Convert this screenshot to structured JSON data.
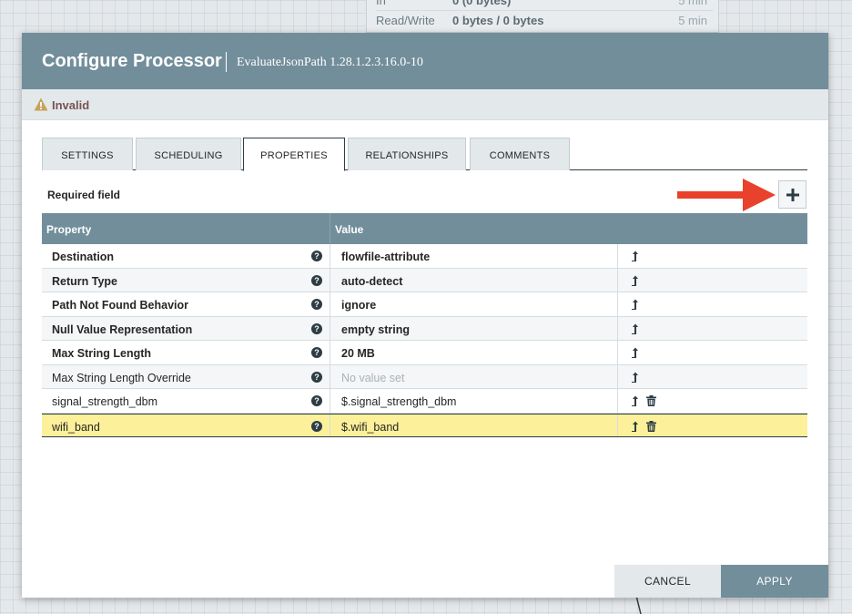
{
  "background": {
    "stats": [
      {
        "label": "In",
        "value": "0 (0 bytes)",
        "time": "5 min"
      },
      {
        "label": "Read/Write",
        "value": "0 bytes / 0 bytes",
        "time": "5 min"
      }
    ]
  },
  "dialog": {
    "title": "Configure Processor",
    "subtitle": "EvaluateJsonPath 1.28.1.2.3.16.0-10",
    "status": "Invalid",
    "tabs": [
      {
        "label": "SETTINGS",
        "active": false
      },
      {
        "label": "SCHEDULING",
        "active": false
      },
      {
        "label": "PROPERTIES",
        "active": true
      },
      {
        "label": "RELATIONSHIPS",
        "active": false
      },
      {
        "label": "COMMENTS",
        "active": false
      }
    ],
    "required_label": "Required field",
    "add_icon": "plus-icon",
    "table": {
      "headers": [
        "Property",
        "Value"
      ],
      "rows": [
        {
          "name": "Destination",
          "value": "flowfile-attribute",
          "required": true,
          "deletable": false
        },
        {
          "name": "Return Type",
          "value": "auto-detect",
          "required": true,
          "deletable": false
        },
        {
          "name": "Path Not Found Behavior",
          "value": "ignore",
          "required": true,
          "deletable": false
        },
        {
          "name": "Null Value Representation",
          "value": "empty string",
          "required": true,
          "deletable": false
        },
        {
          "name": "Max String Length",
          "value": "20 MB",
          "required": true,
          "deletable": false
        },
        {
          "name": "Max String Length Override",
          "value": "No value set",
          "required": false,
          "deletable": false
        },
        {
          "name": "signal_strength_dbm",
          "value": "$.signal_strength_dbm",
          "required": false,
          "deletable": true
        },
        {
          "name": "wifi_band",
          "value": "$.wifi_band",
          "required": false,
          "deletable": true,
          "selected": true
        }
      ]
    },
    "cancel_label": "CANCEL",
    "apply_label": "APPLY"
  },
  "colors": {
    "header": "#728e9b",
    "selected_row": "#fcf09a",
    "annotation_arrow": "#e8412c",
    "warning": "#c9a25b"
  }
}
